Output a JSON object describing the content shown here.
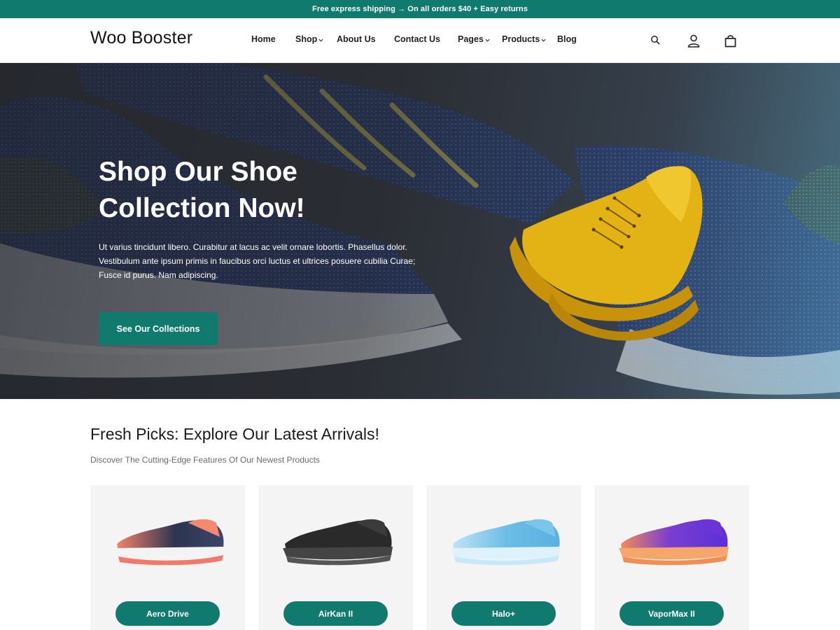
{
  "announcement": "Free express shipping → On all orders $40 + Easy returns",
  "brand": "Woo Booster",
  "nav": {
    "items": [
      {
        "label": "Home",
        "has_dropdown": false
      },
      {
        "label": "Shop",
        "has_dropdown": true
      },
      {
        "label": "About Us",
        "has_dropdown": false
      },
      {
        "label": "Contact Us",
        "has_dropdown": false
      },
      {
        "label": "Pages",
        "has_dropdown": true
      },
      {
        "label": "Products",
        "has_dropdown": true
      },
      {
        "label": "Blog",
        "has_dropdown": false
      }
    ]
  },
  "header_icons": [
    "search-icon",
    "user-icon",
    "shopping-bag-icon"
  ],
  "hero": {
    "title": "Shop Our Shoe Collection Now!",
    "text": "Ut varius tincidunt libero. Curabitur at lacus ac velit ornare lobortis. Phasellus dolor. Vestibulum ante ipsum primis in faucibus orci luctus et ultrices posuere cubilia Curae; Fusce id purus. Nam adipiscing.",
    "button": "See Our Collections"
  },
  "arrivals": {
    "title": "Fresh Picks: Explore Our Latest Arrivals!",
    "subtitle": "Discover The Cutting-Edge Features Of Our Newest Products",
    "products": [
      {
        "name": "Aero Drive"
      },
      {
        "name": "AirKan II"
      },
      {
        "name": "Halo+"
      },
      {
        "name": "VaporMax II"
      }
    ]
  },
  "colors": {
    "accent": "#117a6f",
    "card_bg": "#f4f4f4"
  }
}
